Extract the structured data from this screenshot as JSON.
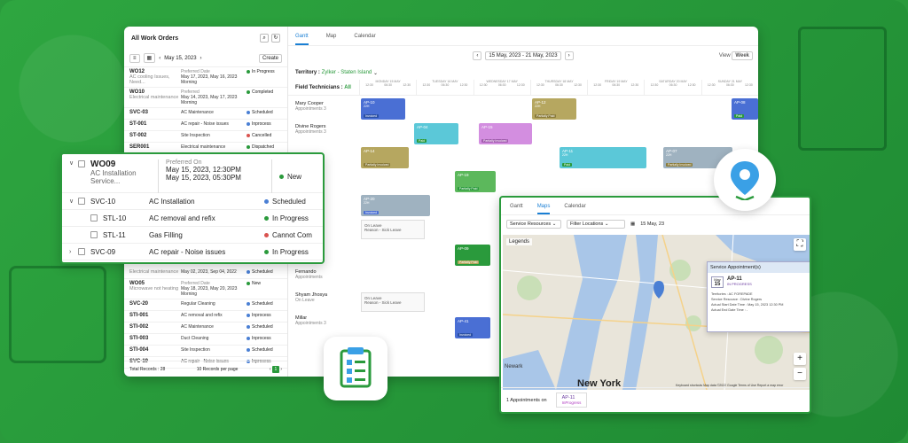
{
  "colors": {
    "brand_green": "#2a9a3c",
    "blue": "#4a7fd4",
    "teal": "#5bc8d8",
    "olive": "#b6a760",
    "pink": "#d38ee0",
    "green_bar": "#5cb85c",
    "gray_bar": "#9fb2c0"
  },
  "work_orders": {
    "title": "All Work Orders",
    "date": "May 15, 2023",
    "create_label": "Create",
    "rows": [
      {
        "id": "WO12",
        "desc": "AC cooling Issues, Need...",
        "pref_label": "Preferred Date",
        "dates": "May 17, 2023, May 16, 2023",
        "time": "Morning",
        "status": "In Progress",
        "color": "#2a9a3c"
      },
      {
        "id": "WO10",
        "desc": "Electrical maintenance",
        "pref_label": "Preferred",
        "dates": "May 14, 2023, May 17, 2023",
        "time": "Morning",
        "status": "Completed",
        "color": "#2a9a3c"
      },
      {
        "id": "SVC-03",
        "desc": "",
        "pref_label": "",
        "dates": "AC Maintenance",
        "time": "",
        "status": "Scheduled",
        "color": "#4a7fd4"
      },
      {
        "id": "ST-001",
        "desc": "",
        "pref_label": "",
        "dates": "AC repair - Noise issues",
        "time": "",
        "status": "Inprocess",
        "color": "#4a7fd4"
      },
      {
        "id": "ST-002",
        "desc": "",
        "pref_label": "",
        "dates": "Site Inspection",
        "time": "",
        "status": "Cancelled",
        "color": "#d9534f"
      },
      {
        "id": "SER001",
        "desc": "",
        "pref_label": "",
        "dates": "Electrical maintenance",
        "time": "",
        "status": "Dispatched",
        "color": "#2a9a3c"
      }
    ],
    "lower_rows": [
      {
        "id": "",
        "desc": "Electrical maintenance",
        "pref_label": "",
        "dates": "May 02, 2023, Sep 04, 2022",
        "time": "",
        "status": "Scheduled",
        "color": "#4a7fd4"
      },
      {
        "id": "WO05",
        "desc": "Microwave not heating",
        "pref_label": "Preferred Date",
        "dates": "May 18, 2023, May 20, 2023",
        "time": "Morning",
        "status": "New",
        "color": "#2a9a3c"
      },
      {
        "id": "SVC-20",
        "desc": "",
        "pref_label": "",
        "dates": "Regular Cleaning",
        "time": "",
        "status": "Scheduled",
        "color": "#4a7fd4"
      },
      {
        "id": "STI-001",
        "desc": "",
        "pref_label": "",
        "dates": "AC removal and refix",
        "time": "",
        "status": "Inprocess",
        "color": "#4a7fd4"
      },
      {
        "id": "STI-002",
        "desc": "",
        "pref_label": "",
        "dates": "AC Maintenance",
        "time": "",
        "status": "Scheduled",
        "color": "#4a7fd4"
      },
      {
        "id": "STI-003",
        "desc": "",
        "pref_label": "",
        "dates": "Duct Cleaning",
        "time": "",
        "status": "Inprocess",
        "color": "#4a7fd4"
      },
      {
        "id": "STI-004",
        "desc": "",
        "pref_label": "",
        "dates": "Site Inspection",
        "time": "",
        "status": "Scheduled",
        "color": "#4a7fd4"
      },
      {
        "id": "SVC-19",
        "desc": "",
        "pref_label": "",
        "dates": "AC repair - Noise issues",
        "time": "",
        "status": "Inprocess",
        "color": "#4a7fd4"
      }
    ],
    "total_label": "Total Records : 28",
    "per_page": "10 Records per page",
    "page": "1"
  },
  "gantt": {
    "tabs": [
      "Gantt",
      "Map",
      "Calendar"
    ],
    "range": "15 May, 2023 - 21 May, 2023",
    "view_label": "View",
    "week_label": "Week",
    "territory_label": "Territory :",
    "territory_value": "Zylker - Staten Island",
    "field_tech_label": "Field Technicians :",
    "field_tech_value": "All",
    "day_labels": [
      "MONDAY 15 MAY",
      "TUESDAY 16 MAY",
      "WEDNESDAY 17 MAY",
      "THURSDAY 18 MAY",
      "FRIDAY 19 MAY",
      "SATURDAY 20 MAY",
      "SUNDAY 21 MAY"
    ],
    "technicians": [
      {
        "name": "Mary Cooper",
        "sub": "Appointments",
        "count": "3"
      },
      {
        "name": "Divine Rogers",
        "sub": "Appointments",
        "count": "3"
      },
      {
        "name": "Fernando",
        "sub": "Appointments",
        "count": ""
      },
      {
        "name": "Shyam Jhosya",
        "sub": "On Leave",
        "count": ""
      },
      {
        "name": "Millar",
        "sub": "Appointments",
        "count": "3"
      }
    ],
    "appointments": [
      {
        "id": "AP-10",
        "sub": "22H",
        "tag": "Invoiced"
      },
      {
        "id": "AP-15",
        "sub": "",
        "tag": "Partially Invoiced"
      },
      {
        "id": "AP-14",
        "sub": "",
        "tag": "Partially Invoiced"
      },
      {
        "id": "AP-12",
        "sub": "22H",
        "tag": "Partially Paid"
      },
      {
        "id": "AP-20",
        "sub": "22H",
        "tag": "Invoiced"
      },
      {
        "id": "AP-11",
        "sub": "22H",
        "tag": "Paid"
      },
      {
        "id": "AP-07",
        "sub": "22H",
        "tag": "Partially Invoiced"
      },
      {
        "id": "AP-19",
        "sub": "",
        "tag": "Partially Paid"
      },
      {
        "id": "AP-41",
        "sub": "",
        "tag": "Invoiced"
      },
      {
        "id": "AP-09",
        "sub": "",
        "tag": "Partially Paid"
      },
      {
        "id": "AP-04",
        "sub": "",
        "tag": "Paid"
      },
      {
        "id": "AP-08",
        "sub": "",
        "tag": "Paid"
      }
    ],
    "leave_title": "On Leave",
    "leave_reason": "Reason - Sick Leave"
  },
  "wo_card": {
    "id": "WO09",
    "desc1": "AC Installation",
    "desc2": "Service...",
    "pref_label": "Preferred On",
    "date1": "May 15, 2023, 12:30PM",
    "date2": "May 15, 2023, 05:30PM",
    "status": "New",
    "rows": [
      {
        "id": "SVC-10",
        "label": "AC Installation",
        "status": "Scheduled",
        "color": "#4a7fd4",
        "indent": 0,
        "chev": "∨"
      },
      {
        "id": "STL-10",
        "label": "AC removal and refix",
        "status": "In Progress",
        "color": "#2a9a3c",
        "indent": 1,
        "chev": ""
      },
      {
        "id": "STL-11",
        "label": "Gas Filling",
        "status": "Cannot Com",
        "color": "#d9534f",
        "indent": 1,
        "chev": ""
      },
      {
        "id": "SVC-09",
        "label": "AC repair - Noise issues",
        "status": "In Progress",
        "color": "#2a9a3c",
        "indent": 0,
        "chev": "›"
      }
    ]
  },
  "map_win": {
    "tabs": [
      "Gantt",
      "Maps",
      "Calendar"
    ],
    "filter1": "Service Resources",
    "filter2": "Filter Locations",
    "date": "15 May, 23",
    "legends": "Legends",
    "city": "New York",
    "newark": "Newark",
    "popup_title": "Service Appointment(s)",
    "popup_id": "AP-11",
    "popup_status": "IN PROGRESS",
    "popup_day": "15",
    "popup_month": "May",
    "popup_lines": [
      "Territories : AC FOREPADE",
      "Service Resource : Divine Rogers",
      "Actual Start Date Time : May 15, 2023 12:30 PM",
      "Actual End Date Time : -"
    ],
    "footer_label": "1 Appointments on",
    "footer_id": "AP-11",
    "footer_status": "InProgress",
    "attribution": "Keyboard shortcuts   Map data ©2022 Google   Terms of Use   Report a map error"
  }
}
